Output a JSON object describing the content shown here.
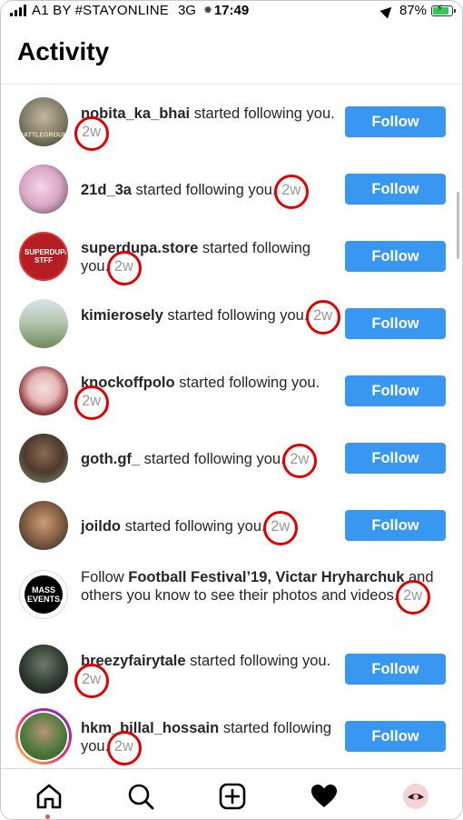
{
  "status_bar": {
    "carrier": "A1 BY #STAYONLINE",
    "network": "3G",
    "time": "17:49",
    "battery": "87%",
    "battery_level": 0.87,
    "battery_color": "#34c759"
  },
  "header": {
    "title": "Activity"
  },
  "theme": {
    "follow_button_color": "#3897f0",
    "highlight_circle_color": "#e00000",
    "timestamp_color": "#999999"
  },
  "activity": {
    "items": [
      {
        "username": "nobita_ka_bhai",
        "action": " started following you.",
        "time": "2w",
        "button": "Follow",
        "avatar": "game-character-avatar"
      },
      {
        "username": "21d_3a",
        "action": " started following you.",
        "time": "2w",
        "button": "Follow",
        "avatar": "pink-portrait-avatar"
      },
      {
        "username": "superdupa.store",
        "action": " started following you.",
        "time": "2w",
        "button": "Follow",
        "avatar": "store-logo-avatar",
        "avatar_text": "SUPERDUPA STFF"
      },
      {
        "username": "kimierosely",
        "action": " started following you.",
        "time": "2w",
        "button": "Follow",
        "avatar": "outdoor-portrait-avatar"
      },
      {
        "username": "knockoffpolo",
        "action": " started following you.",
        "time": "2w",
        "button": "Follow",
        "avatar": "cartoon-avatar"
      },
      {
        "username": "goth.gf_",
        "action": " started following you.",
        "time": "2w",
        "button": "Follow",
        "avatar": "portrait-avatar"
      },
      {
        "username": "joildo",
        "action": " started following you.",
        "time": "2w",
        "button": "Follow",
        "avatar": "portrait-avatar"
      }
    ],
    "suggestion": {
      "prefix": "Follow ",
      "names": "Football Festival’19, Victar Hryharchuk",
      "suffix": " and others you know to see their photos and videos.",
      "time": "2w",
      "avatar": "mass-events-logo-avatar",
      "avatar_text": "MASS EVENTS."
    },
    "items_after": [
      {
        "username": "breezyfairytale",
        "action": " started following you.",
        "time": "2w",
        "button": "Follow",
        "avatar": "portrait-avatar"
      },
      {
        "username": "hkm_billal_hossain",
        "action": " started following you.",
        "time": "2w",
        "button": "Follow",
        "avatar": "story-ring-avatar"
      }
    ]
  },
  "tab_bar": {
    "tabs": [
      "home-icon",
      "search-icon",
      "new-post-icon",
      "activity-heart-icon",
      "profile-avatar-icon"
    ],
    "active": "home-icon"
  }
}
